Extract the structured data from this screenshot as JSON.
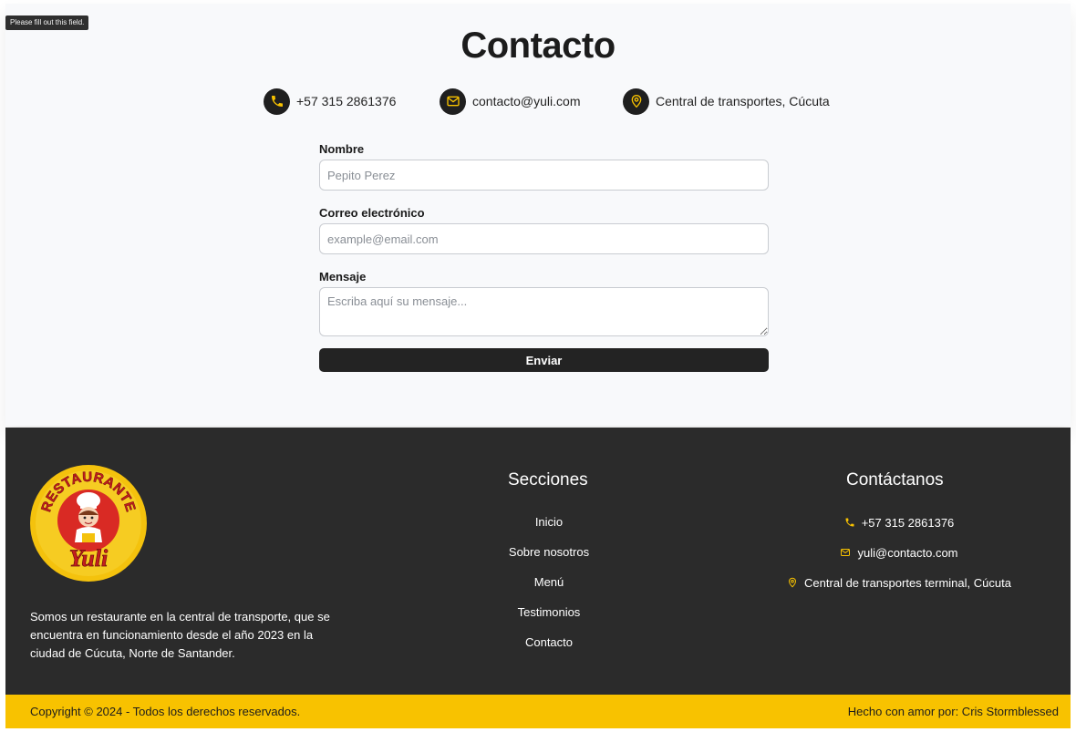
{
  "tooltip": {
    "text": "Please fill out this field."
  },
  "contact": {
    "title": "Contacto",
    "info": {
      "phone": "+57 315 2861376",
      "email": "contacto@yuli.com",
      "address": "Central de transportes, Cúcuta"
    }
  },
  "form": {
    "name_label": "Nombre",
    "name_placeholder": "Pepito Perez",
    "email_label": "Correo electrónico",
    "email_placeholder": "example@email.com",
    "message_label": "Mensaje",
    "message_placeholder": "Escriba aquí su mensaje...",
    "submit_label": "Enviar"
  },
  "footer": {
    "logo": {
      "top_text": "RESTAURANTE",
      "bottom_text": "Yuli"
    },
    "about": "Somos un restaurante en la central de transporte, que se encuentra en funcionamiento desde el año 2023 en la ciudad de Cúcuta, Norte de Santander.",
    "sections_title": "Secciones",
    "sections": [
      "Inicio",
      "Sobre nosotros",
      "Menú",
      "Testimonios",
      "Contacto"
    ],
    "contact_title": "Contáctanos",
    "contact": {
      "phone": "+57 315 2861376",
      "email": "yuli@contacto.com",
      "address": "Central de transportes terminal, Cúcuta"
    },
    "copyright": "Copyright © 2024 - Todos los derechos reservados.",
    "credit": "Hecho con amor por: Cris Stormblessed"
  },
  "colors": {
    "accent": "#f8c200",
    "footer_bg": "#2b2b2b",
    "button_bg": "#232323"
  },
  "icons": {
    "phone": "phone-icon",
    "email": "envelope-icon",
    "address": "map-pin-icon"
  }
}
